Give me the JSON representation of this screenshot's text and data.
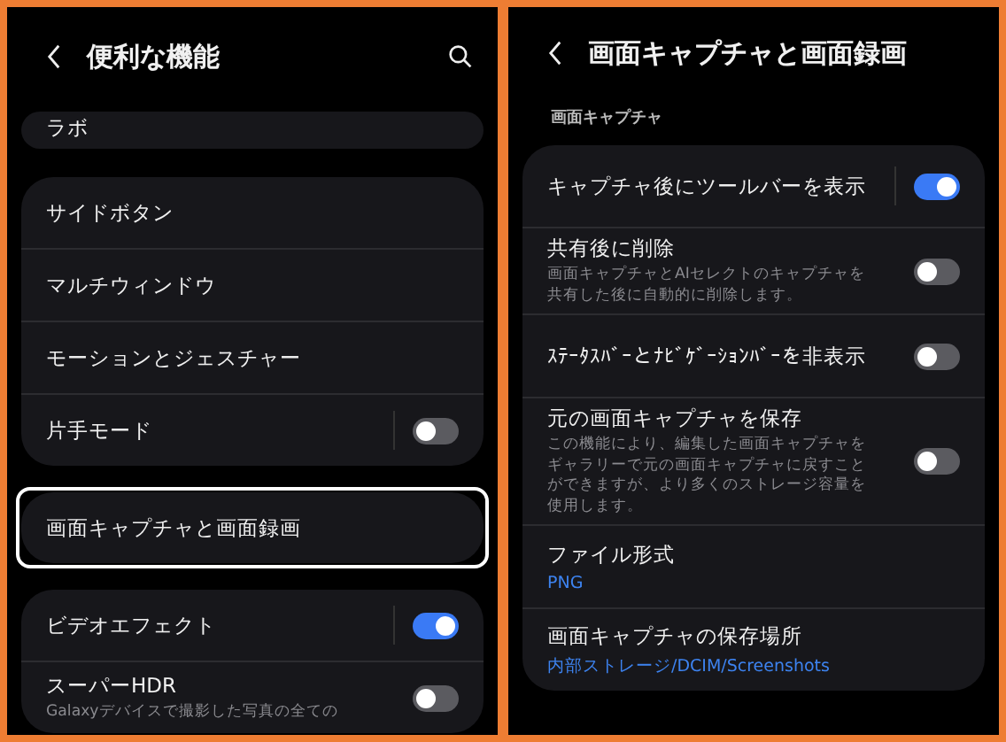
{
  "left": {
    "title": "便利な機能",
    "groups": [
      {
        "highlighted": false,
        "items": [
          {
            "kind": "link",
            "label": "ラボ"
          }
        ]
      },
      {
        "highlighted": false,
        "items": [
          {
            "kind": "link",
            "label": "サイドボタン"
          },
          {
            "kind": "link",
            "label": "マルチウィンドウ"
          },
          {
            "kind": "link",
            "label": "モーションとジェスチャー"
          },
          {
            "kind": "switch",
            "label": "片手モード",
            "separator": true,
            "on": false
          }
        ]
      },
      {
        "highlighted": true,
        "items": [
          {
            "kind": "link",
            "label": "画面キャプチャと画面録画"
          }
        ]
      },
      {
        "highlighted": false,
        "items": [
          {
            "kind": "switch",
            "label": "ビデオエフェクト",
            "separator": true,
            "on": true
          },
          {
            "kind": "switch",
            "label": "スーパーHDR",
            "description": "Galaxyデバイスで撮影した写真の全ての",
            "separator": false,
            "on": false
          }
        ]
      }
    ]
  },
  "right": {
    "title": "画面キャプチャと画面録画",
    "section": "画面キャプチャ",
    "groups": [
      {
        "highlighted": false,
        "items": [
          {
            "kind": "switch",
            "label": "キャプチャ後にツールバーを表示",
            "separator": true,
            "on": true
          },
          {
            "kind": "switch",
            "label": "共有後に削除",
            "description": "画面キャプチャとAIセレクトのキャプチャを共有した後に自動的に削除します。",
            "separator": false,
            "on": false
          },
          {
            "kind": "switch",
            "label": "ｽﾃｰﾀｽﾊﾞｰとﾅﾋﾞｹﾞｰｼｮﾝﾊﾞｰを非表示",
            "separator": false,
            "on": false
          },
          {
            "kind": "switch",
            "label": "元の画面キャプチャを保存",
            "description": "この機能により、編集した画面キャプチャをギャラリーで元の画面キャプチャに戻すことができますが、より多くのストレージ容量を使用します。",
            "separator": false,
            "on": false
          },
          {
            "kind": "value",
            "label": "ファイル形式",
            "value": "PNG"
          },
          {
            "kind": "value",
            "label": "画面キャプチャの保存場所",
            "value": "内部ストレージ/DCIM/Screenshots"
          }
        ]
      }
    ]
  }
}
